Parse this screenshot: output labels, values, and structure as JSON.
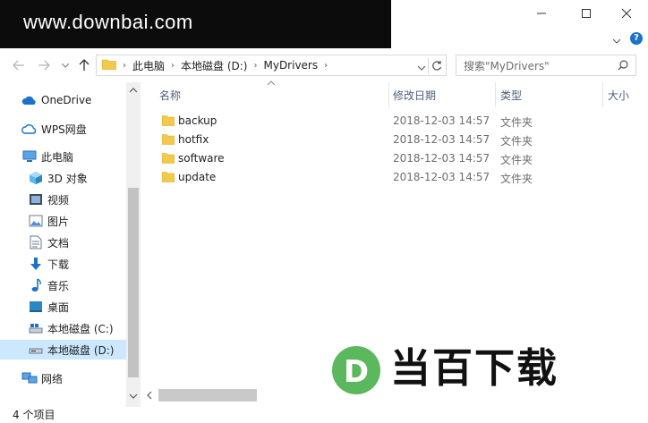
{
  "watermark": {
    "text": "www.downbai.com"
  },
  "window": {
    "help": "?"
  },
  "address": {
    "crumbs": [
      "此电脑",
      "本地磁盘 (D:)",
      "MyDrivers"
    ]
  },
  "search": {
    "placeholder": "搜索\"MyDrivers\""
  },
  "nav": {
    "items": [
      {
        "label": "OneDrive",
        "icon": "cloud-icon"
      },
      {
        "label": "WPS网盘",
        "icon": "wps-cloud-icon"
      },
      {
        "label": "此电脑",
        "icon": "pc-icon"
      },
      {
        "label": "3D 对象",
        "icon": "cube-icon"
      },
      {
        "label": "视频",
        "icon": "video-icon"
      },
      {
        "label": "图片",
        "icon": "picture-icon"
      },
      {
        "label": "文档",
        "icon": "document-icon"
      },
      {
        "label": "下载",
        "icon": "download-icon"
      },
      {
        "label": "音乐",
        "icon": "music-icon"
      },
      {
        "label": "桌面",
        "icon": "desktop-icon"
      },
      {
        "label": "本地磁盘 (C:)",
        "icon": "drive-icon"
      },
      {
        "label": "本地磁盘 (D:)",
        "icon": "drive-icon",
        "selected": true
      },
      {
        "label": "网络",
        "icon": "network-icon"
      }
    ]
  },
  "columns": {
    "name": "名称",
    "modified": "修改日期",
    "type": "类型",
    "size": "大小"
  },
  "files": [
    {
      "name": "backup",
      "modified": "2018-12-03 14:57",
      "type": "文件夹"
    },
    {
      "name": "hotfix",
      "modified": "2018-12-03 14:57",
      "type": "文件夹"
    },
    {
      "name": "software",
      "modified": "2018-12-03 14:57",
      "type": "文件夹"
    },
    {
      "name": "update",
      "modified": "2018-12-03 14:57",
      "type": "文件夹"
    }
  ],
  "status": {
    "count": "4 个项目"
  },
  "brand": {
    "text": "当百下载",
    "logo_letter": "D"
  },
  "colors": {
    "accent": "#1a73c8",
    "selected": "#cce8ff",
    "folder": "#f2c94c",
    "brand_green": "#5cb85c"
  }
}
